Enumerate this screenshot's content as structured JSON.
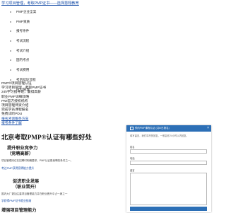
{
  "header": {
    "top_link": "学习项目管理，考取PMP证书——选择慧翔教育"
  },
  "nav": {
    "items": [
      {
        "label": "PMP企业全案"
      },
      {
        "label": "PMP资质"
      },
      {
        "label": "报考条件"
      },
      {
        "label": "考试流程"
      },
      {
        "label": "考试介绍"
      },
      {
        "label": "国内考点"
      },
      {
        "label": "考试费用"
      },
      {
        "label": "考后续证流程"
      },
      {
        "label": "PDU管理"
      }
    ]
  },
  "text_block": {
    "lines": [
      "PMP®项目管理认证",
      "学习项目管理，考取PMP证书",
      "24h学习指导班，赢得高薪",
      "职业PMP详细攻略",
      "PMI官方授权机构",
      "项目管理师资介绍",
      "完成学员课程报名",
      "免费试听PDU"
    ],
    "links": [
      "报名咨询服务方向",
      "报考条件了解"
    ]
  },
  "main": {
    "heading": "北京考取PMP®认证有哪些好处",
    "sec1_title_line1": "提升职业竞争力",
    "sec1_title_line2": "（竞聘高薪）",
    "sec1_text": "项目管理岗位在招聘时明确要求，PMP认证是竞聘的条件之一。",
    "sec1_link": "考过PMP获得竞聘能力提升",
    "sec2_title_line1": "促进职业发展",
    "sec2_title_line2": "（职业晋升）",
    "sec2_text": "国内大厂更加注重项目管理能力并在职业晋升中占一席之一",
    "sec2_link": "学获得PMP证书就业指南",
    "sec3_title": "增强项目管理能力"
  },
  "modal": {
    "title": "预约PMP课程认证 (共6/日报名)",
    "close_label": "×",
    "intro": "填写留言，我们将尽快回复。一般会在24小时以内回复。",
    "name_label": "姓名",
    "phone_label": "电话",
    "message_label": "留言"
  }
}
